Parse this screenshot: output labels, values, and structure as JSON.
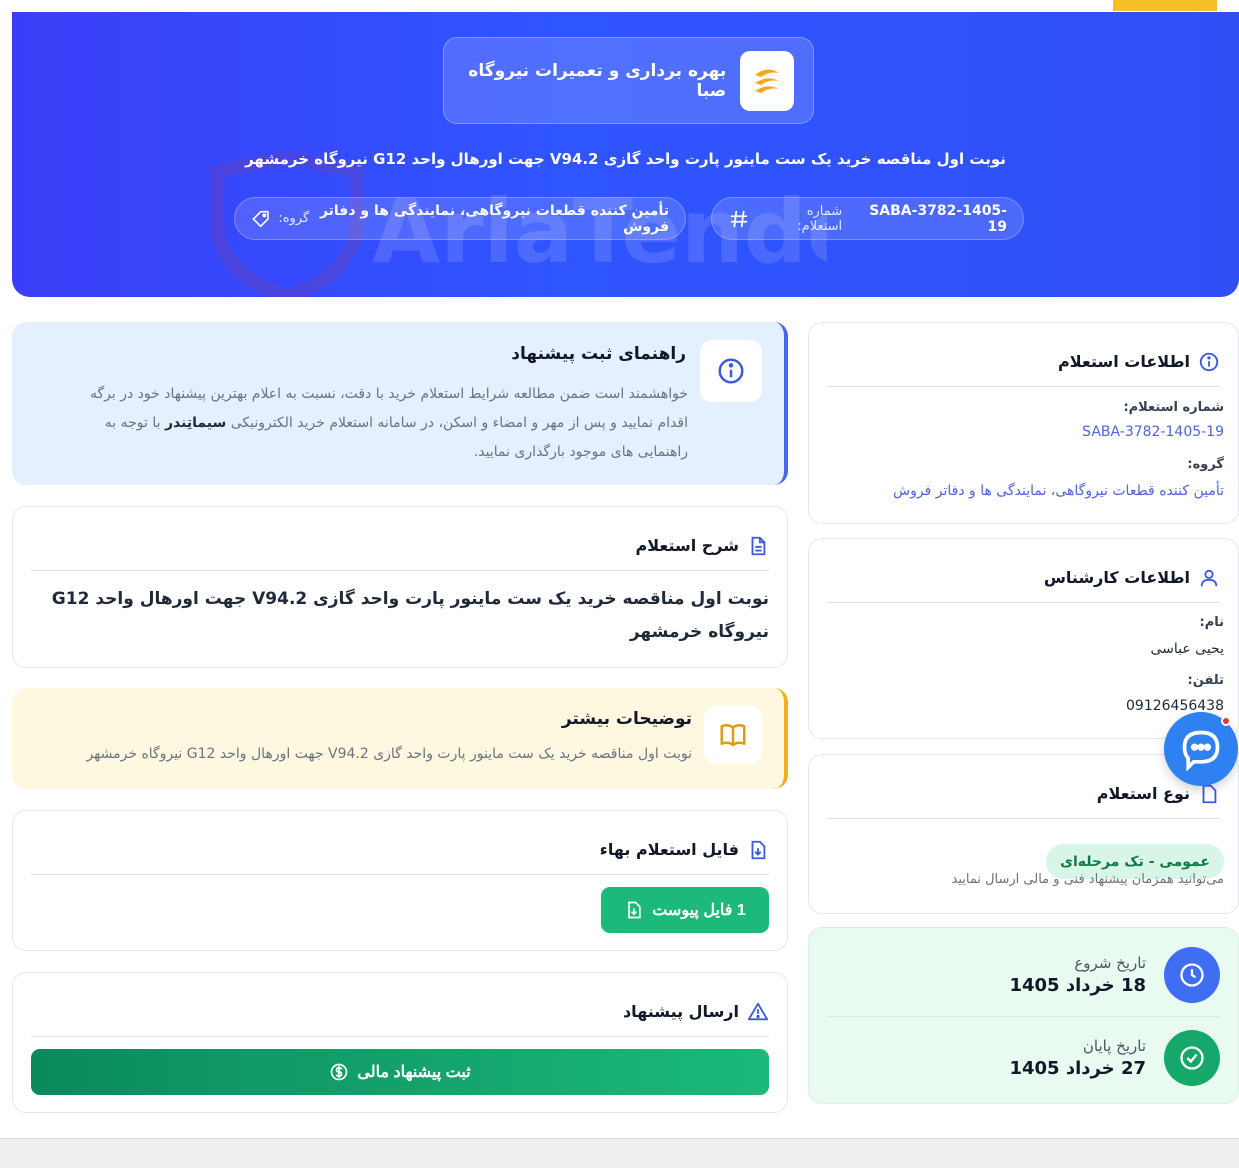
{
  "brand": {
    "name": "بهره برداری و تعمیرات نیروگاه صبا"
  },
  "hero": {
    "title": "نوبت اول مناقصه خرید یک ست ماینور پارت واحد گازی V94.2 جهت اورهال واحد G12 نیروگاه خرمشهر",
    "number_label": "شماره استعلام:",
    "number_value": "SABA-3782-1405-19",
    "group_label": "گروه:",
    "group_value": "تأمین کننده قطعات نیروگاهی، نمایندگی ها و دفاتر فروش"
  },
  "inquiry_info": {
    "title": "اطلاعات استعلام",
    "number_label": "شماره استعلام:",
    "number_value": "SABA-3782-1405-19",
    "group_label": "گروه:",
    "group_value": "تأمین کننده قطعات نیروگاهی، نمایندگی ها و دفاتر فروش"
  },
  "expert": {
    "title": "اطلاعات کارشناس",
    "name_label": "نام:",
    "name_value": "یحیی عباسی",
    "phone_label": "تلفن:",
    "phone_value": "09126456438"
  },
  "inquiry_type": {
    "title": "نوع استعلام",
    "badge": "عمومی - تک مرحله‌ای",
    "note": "می‌توانید همزمان پیشنهاد فنی و مالی ارسال نمایید"
  },
  "dates": {
    "start_label": "تاریخ شروع",
    "start_value": "18 خرداد 1405",
    "end_label": "تاریخ پایان",
    "end_value": "27 خرداد 1405"
  },
  "guide": {
    "title": "راهنمای ثبت پیشنهاد",
    "line1": "خواهشمند است ضمن مطالعه شرایط استعلام خرید با دقت، نسبت به اعلام بهترین پیشنهاد خود در برگه",
    "line2_a": "اقدام نمایید و پس از مهر و امضاء و اسکن، در سامانه استعلام خرید الکترونیکی",
    "line2_brand": "سیماتِندر",
    "line2_b": "با توجه به",
    "line3": "راهنمایی های موجود بارگذاری نمایید."
  },
  "description": {
    "title": "شرح استعلام",
    "text": "نوبت اول مناقصه خرید یک ست ماینور پارت واحد گازی V94.2 جهت اورهال واحد G12 نیروگاه خرمشهر"
  },
  "more": {
    "title": "توضیحات بیشتر",
    "text": "نوبت اول مناقصه خرید یک ست ماینور پارت واحد گازی V94.2 جهت اورهال واحد G12 نیروگاه خرمشهر"
  },
  "file": {
    "title": "فایل استعلام بهاء",
    "button": "1 فایل پیوست"
  },
  "submit": {
    "title": "ارسال پیشنهاد",
    "button": "ثبت پیشنهاد مالی"
  },
  "colors": {
    "hero_blue": "#2f55ff",
    "accent_green": "#1cb97a",
    "link_blue": "#4f63d8",
    "warning_amber": "#f2b01e",
    "chat_blue": "#2f80f0"
  },
  "icons": [
    "hash-icon",
    "tag-icon",
    "info-icon",
    "user-icon",
    "document-icon",
    "clock-icon",
    "check-circle-icon",
    "book-icon",
    "file-download-icon",
    "warning-triangle-icon",
    "dollar-icon",
    "chat-icon"
  ]
}
